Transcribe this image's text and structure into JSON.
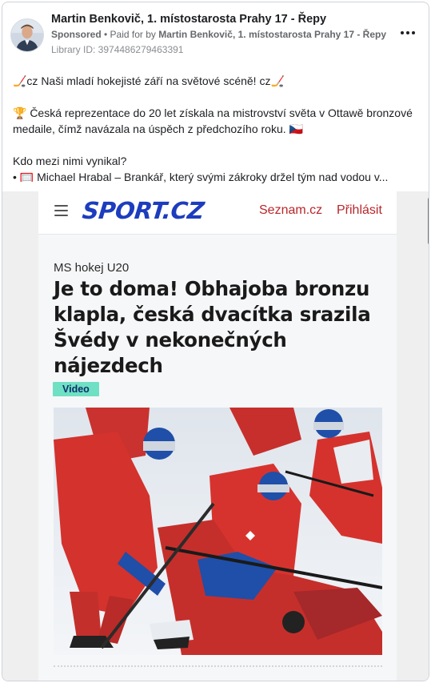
{
  "ad": {
    "page_name": "Martin Benkovič, 1. místostarosta Prahy 17 - Řepy",
    "sponsored_label": "Sponsored",
    "paid_for_prefix": " • Paid for by ",
    "paid_for_name": "Martin Benkovič, 1. místostarosta Prahy 17 - Řepy",
    "library_id": "Library ID: 3974486279463391",
    "more_icon": "more-horizontal-icon"
  },
  "post": {
    "line1": "🏒cz Naši mladí hokejisté září na světové scéně! cz🏒",
    "line2": "🏆 Česká reprezentace do 20 let získala na mistrovství světa v Ottawě bronzové",
    "line3": "medaile, čímž navázala na úspěch z předchozího roku. 🇨🇿",
    "line4": "Kdo mezi nimi vynikal?",
    "line5": "• 🥅 Michael Hrabal – Brankář, který svými zákroky držel tým nad vodou v..."
  },
  "article": {
    "logo": "SPORT.CZ",
    "seznam_link": "Seznam.cz",
    "login_link": "Přihlásit",
    "section": "MS hokej U20",
    "headline": "Je to doma! Obhajoba bronzu klapla, česká dvacítka srazila Švédy v nekonečných nájezdech",
    "badge": "Video",
    "menu_icon": "hamburger-menu-icon"
  },
  "colors": {
    "brand_blue": "#1d3dbe",
    "link_red": "#b8262b",
    "badge_bg": "#6fe0c4"
  }
}
